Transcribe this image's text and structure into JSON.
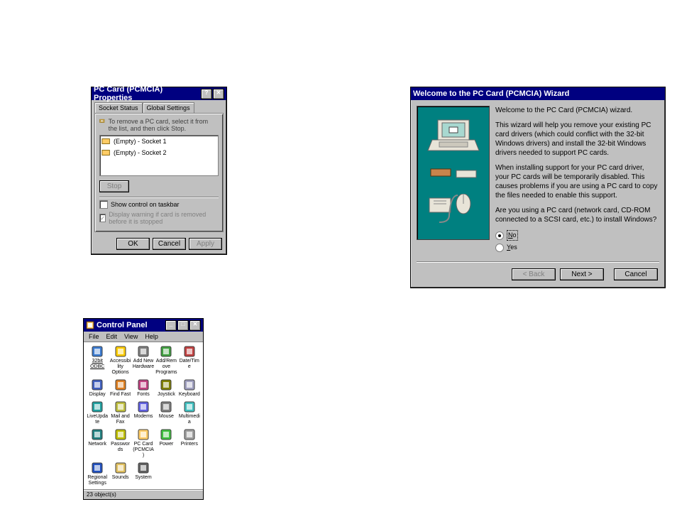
{
  "props": {
    "title": "PC Card (PCMCIA) Properties",
    "tabs": [
      "Socket Status",
      "Global Settings"
    ],
    "instruction": "To remove a PC card, select it from the list, and then click Stop.",
    "sockets": [
      "(Empty) - Socket 1",
      "(Empty) - Socket 2"
    ],
    "stop_btn": "Stop",
    "show_control": "Show control on taskbar",
    "display_warning": "Display warning if card is removed before it is stopped",
    "ok": "OK",
    "cancel": "Cancel",
    "apply": "Apply"
  },
  "wizard": {
    "title": "Welcome to the PC Card (PCMCIA) Wizard",
    "heading": "Welcome to the PC Card (PCMCIA) wizard.",
    "para1": "This wizard will help you remove your existing PC card drivers (which could conflict with the 32-bit Windows drivers) and install the 32-bit Windows drivers needed to support PC cards.",
    "para2": "When installing support for your PC card driver, your PC cards will be temporarily disabled. This causes problems if you are using a PC card to copy the files needed to enable this support.",
    "para3": "Are you using a PC card (network card, CD-ROM connected to a SCSI card, etc.) to install Windows?",
    "no": "No",
    "yes": "Yes",
    "back": "< Back",
    "next": "Next >",
    "cancel": "Cancel"
  },
  "cpanel": {
    "title": "Control Panel",
    "menus": [
      "File",
      "Edit",
      "View",
      "Help"
    ],
    "items": [
      "32bit ODBC",
      "Accessibility Options",
      "Add New Hardware",
      "Add/Remove Programs",
      "Date/Time",
      "Display",
      "Find Fast",
      "Fonts",
      "Joystick",
      "Keyboard",
      "LiveUpdate",
      "Mail and Fax",
      "Modems",
      "Mouse",
      "Multimedia",
      "Network",
      "Passwords",
      "PC Card (PCMCIA)",
      "Power",
      "Printers",
      "Regional Settings",
      "Sounds",
      "System"
    ],
    "status": "23 object(s)"
  }
}
